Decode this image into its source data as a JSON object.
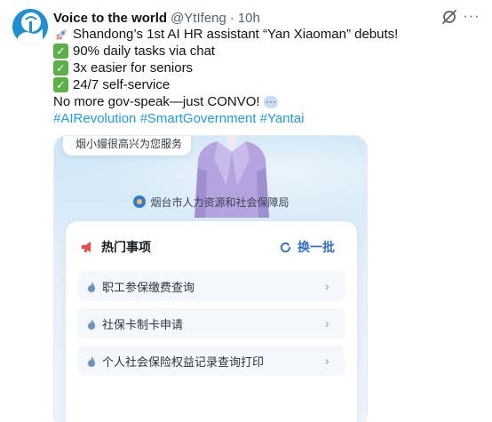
{
  "tweet": {
    "author": {
      "display_name": "Voice to the world",
      "handle": "@YtIfeng",
      "separator": "·",
      "time": "10h"
    },
    "lines": [
      {
        "emoji": "rocket-icon",
        "text": "Shandong’s 1st AI HR assistant “Yan Xiaoman” debuts!"
      },
      {
        "emoji": "check-mark-icon",
        "text": "90% daily tasks via chat"
      },
      {
        "emoji": "check-mark-icon",
        "text": "3x easier for seniors"
      },
      {
        "emoji": "check-mark-icon",
        "text": "24/7 self-service"
      },
      {
        "emoji": "speech-bubble-icon",
        "text": "No more gov-speak—just CONVO!"
      }
    ],
    "hashtags": [
      "#AIRevolution",
      "#SmartGovernment",
      "#Yantai"
    ],
    "more_label": "···"
  },
  "media": {
    "speech_bubble": "烟小嫚很高兴为您服务",
    "bureau_name": "烟台市人力资源和社会保障局",
    "card": {
      "title": "热门事项",
      "refresh_label": "换一批",
      "items": [
        {
          "label": "职工参保缴费查询"
        },
        {
          "label": "社保卡制卡申请"
        },
        {
          "label": "个人社会保险权益记录查询打印"
        }
      ]
    }
  },
  "colors": {
    "link": "#1d9bf0",
    "check": "#5ab145",
    "card_accent": "#2f6fd6"
  }
}
